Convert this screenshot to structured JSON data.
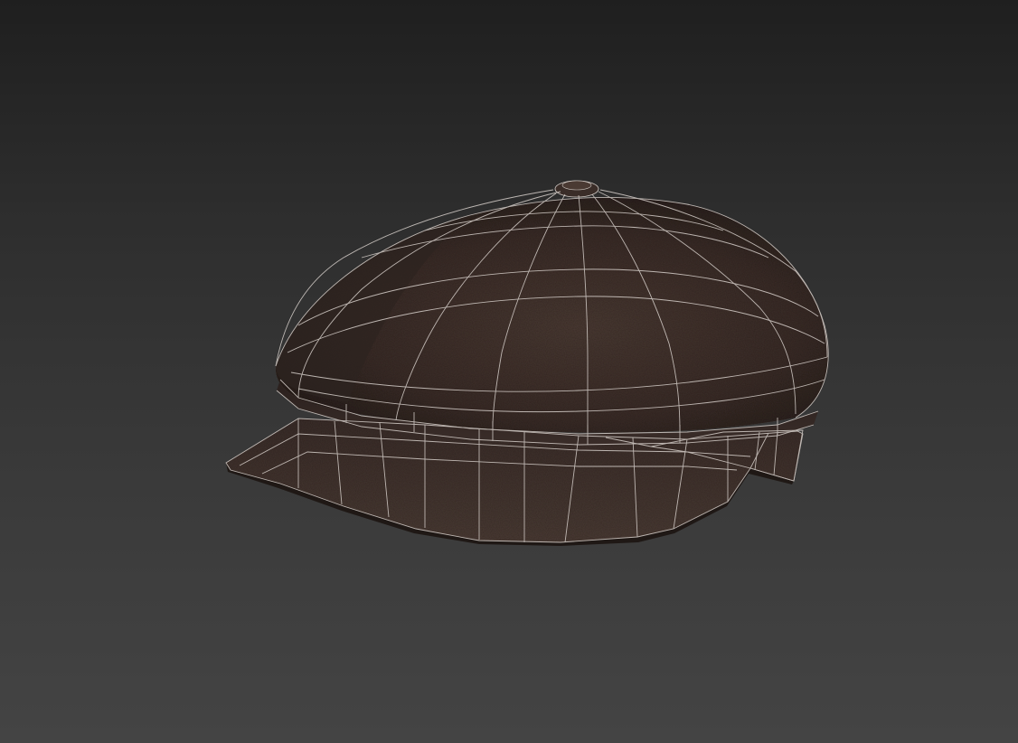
{
  "viewport": {
    "mode": "perspective",
    "shading": "textured-with-wireframe-overlay"
  },
  "model": {
    "object_type": "newsboy-cap",
    "material_color": "#3e302b",
    "material_shadow": "#1f1714",
    "material_highlight": "#5a4840",
    "wireframe_color": "#cfc8c3",
    "background_top": "#1f1f1f",
    "background_bottom": "#444444"
  }
}
